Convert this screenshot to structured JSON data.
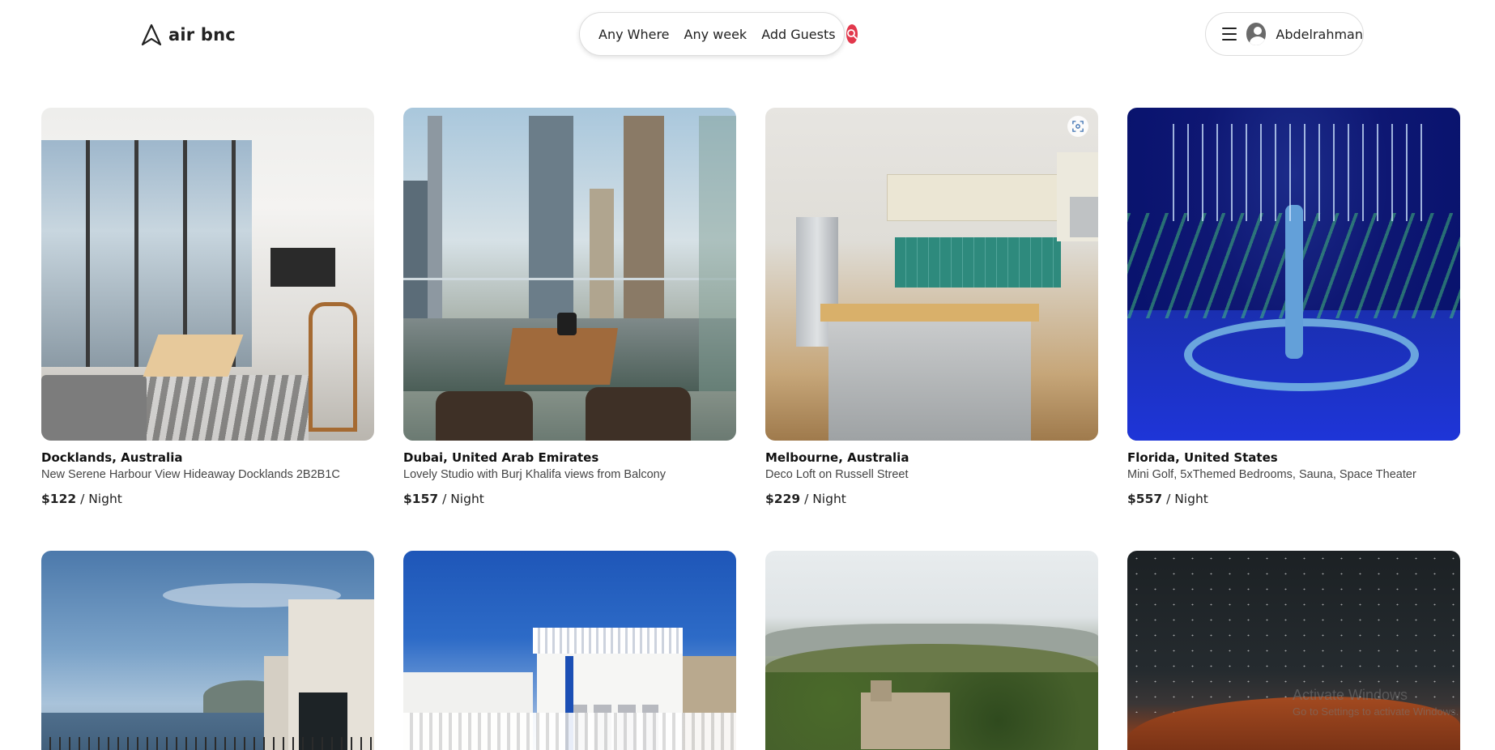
{
  "brand": {
    "name": "air bnc"
  },
  "search": {
    "where": "Any Where",
    "week": "Any week",
    "guests": "Add Guests"
  },
  "user": {
    "name": "Abdelrahman"
  },
  "icons": {
    "logo": "airbnb-logo-icon",
    "search": "search-icon",
    "menu": "hamburger-menu-icon",
    "avatar": "user-avatar-icon",
    "scan": "scan-icon"
  },
  "colors": {
    "accent": "#e2384c"
  },
  "listings": [
    {
      "location": "Docklands, Australia",
      "description": "New Serene Harbour View Hideaway Docklands 2B2B1C",
      "price": "$122",
      "unit": " / Night"
    },
    {
      "location": "Dubai, United Arab Emirates",
      "description": "Lovely Studio with Burj Khalifa views from Balcony",
      "price": "$157",
      "unit": " / Night"
    },
    {
      "location": "Melbourne, Australia",
      "description": "Deco Loft on Russell Street",
      "price": "$229",
      "unit": " / Night"
    },
    {
      "location": "Florida, United States",
      "description": "Mini Golf, 5xThemed Bedrooms, Sauna, Space Theater",
      "price": "$557",
      "unit": " / Night"
    }
  ],
  "watermark": {
    "title": "Activate Windows",
    "subtitle": "Go to Settings to activate Windows."
  }
}
